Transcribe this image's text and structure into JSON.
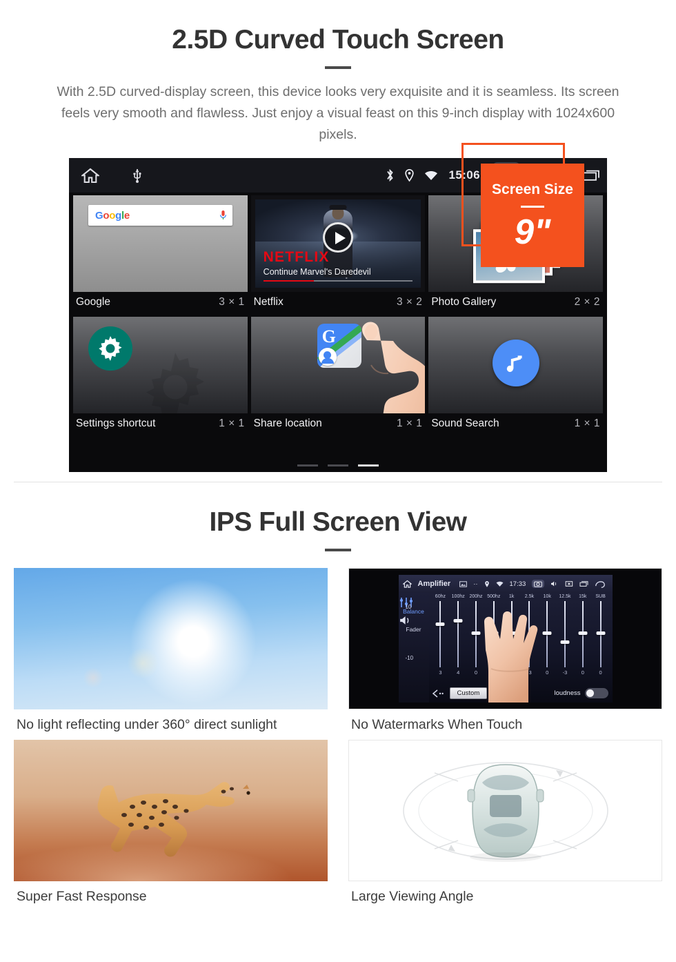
{
  "section1": {
    "title": "2.5D Curved Touch Screen",
    "description": "With 2.5D curved-display screen, this device looks very exquisite and it is seamless. Its screen feels very smooth and flawless. Just enjoy a visual feast on this 9-inch display with 1024x600 pixels.",
    "badge": {
      "label": "Screen Size",
      "value": "9\"",
      "color": "#F4511E"
    },
    "screenshot": {
      "statusbar": {
        "clock": "15:06",
        "left_icons": [
          "home-icon",
          "usb-icon"
        ],
        "right_icons": [
          "bluetooth-icon",
          "location-icon",
          "wifi-icon",
          "camera-icon",
          "volume-icon",
          "close-box-icon",
          "recents-icon"
        ]
      },
      "widgets": [
        {
          "name": "Google",
          "size": "3 × 1",
          "icon": "google-search-widget",
          "search_logo": "Google",
          "mic": "microphone-icon"
        },
        {
          "name": "Netflix",
          "size": "3 × 2",
          "icon": "netflix-widget",
          "brand": "NETFLIX",
          "subtitle": "Continue Marvel's Daredevil",
          "progress": 34
        },
        {
          "name": "Photo Gallery",
          "size": "2 × 2",
          "icon": "photo-gallery-widget"
        },
        {
          "name": "Settings shortcut",
          "size": "1 × 1",
          "icon": "gear-icon"
        },
        {
          "name": "Share location",
          "size": "1 × 1",
          "icon": "google-maps-icon"
        },
        {
          "name": "Sound Search",
          "size": "1 × 1",
          "icon": "music-note-icon"
        }
      ],
      "pager": {
        "pages": 3,
        "active": 3
      }
    }
  },
  "section2": {
    "title": "IPS Full Screen View",
    "cards": [
      {
        "label": "No light reflecting under 360° direct sunlight",
        "media": "blue-sky-sun-photo"
      },
      {
        "label": "No Watermarks When Touch",
        "media": "amplifier-equalizer-screen"
      },
      {
        "label": "Super Fast Response",
        "media": "running-cheetah-photo"
      },
      {
        "label": "Large Viewing Angle",
        "media": "car-top-view-diagram"
      }
    ]
  },
  "amplifier": {
    "title": "Amplifier",
    "clock": "17:33",
    "statusbar_icons": [
      "gallery-icon",
      "dots-icon",
      "location-icon",
      "wifi-icon",
      "camera-icon",
      "volume-icon",
      "close-box-icon",
      "recents-icon",
      "back-icon"
    ],
    "side": {
      "balance": "Balance",
      "fader": "Fader",
      "balance_icon": "sliders-icon",
      "fader_icon": "speaker-icon"
    },
    "scale": {
      "max": "10",
      "min": "-10"
    },
    "bands": [
      "60hz",
      "100hz",
      "200hz",
      "500hz",
      "1k",
      "2.5k",
      "10k",
      "12.5k",
      "15k",
      "SUB"
    ],
    "values": [
      "3",
      "4",
      "0",
      "0",
      "0",
      "-3",
      "0",
      "-3",
      "0",
      "0"
    ],
    "preset_button": "Custom",
    "loudness_label": "loudness",
    "loudness_on": false,
    "back_icon": "back-arrow-icon"
  }
}
